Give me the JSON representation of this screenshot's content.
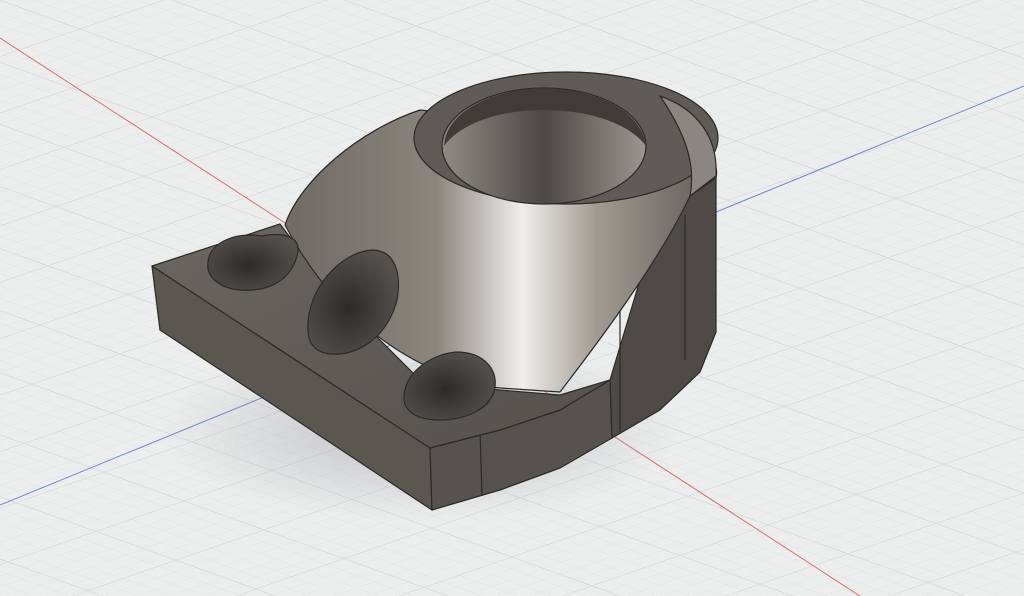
{
  "viewport": {
    "background": "#eceded",
    "grid_minor_color": "#dcdee0",
    "grid_major_color": "#c9ccd0",
    "x_axis_color": "#e06a6a",
    "y_axis_color": "#6f86d8"
  },
  "model": {
    "body_color": "#6b6660",
    "face_dark": "#4a4743",
    "face_light": "#efefed",
    "edge_color": "#2b2a28",
    "hole_color": "#3a3936"
  }
}
